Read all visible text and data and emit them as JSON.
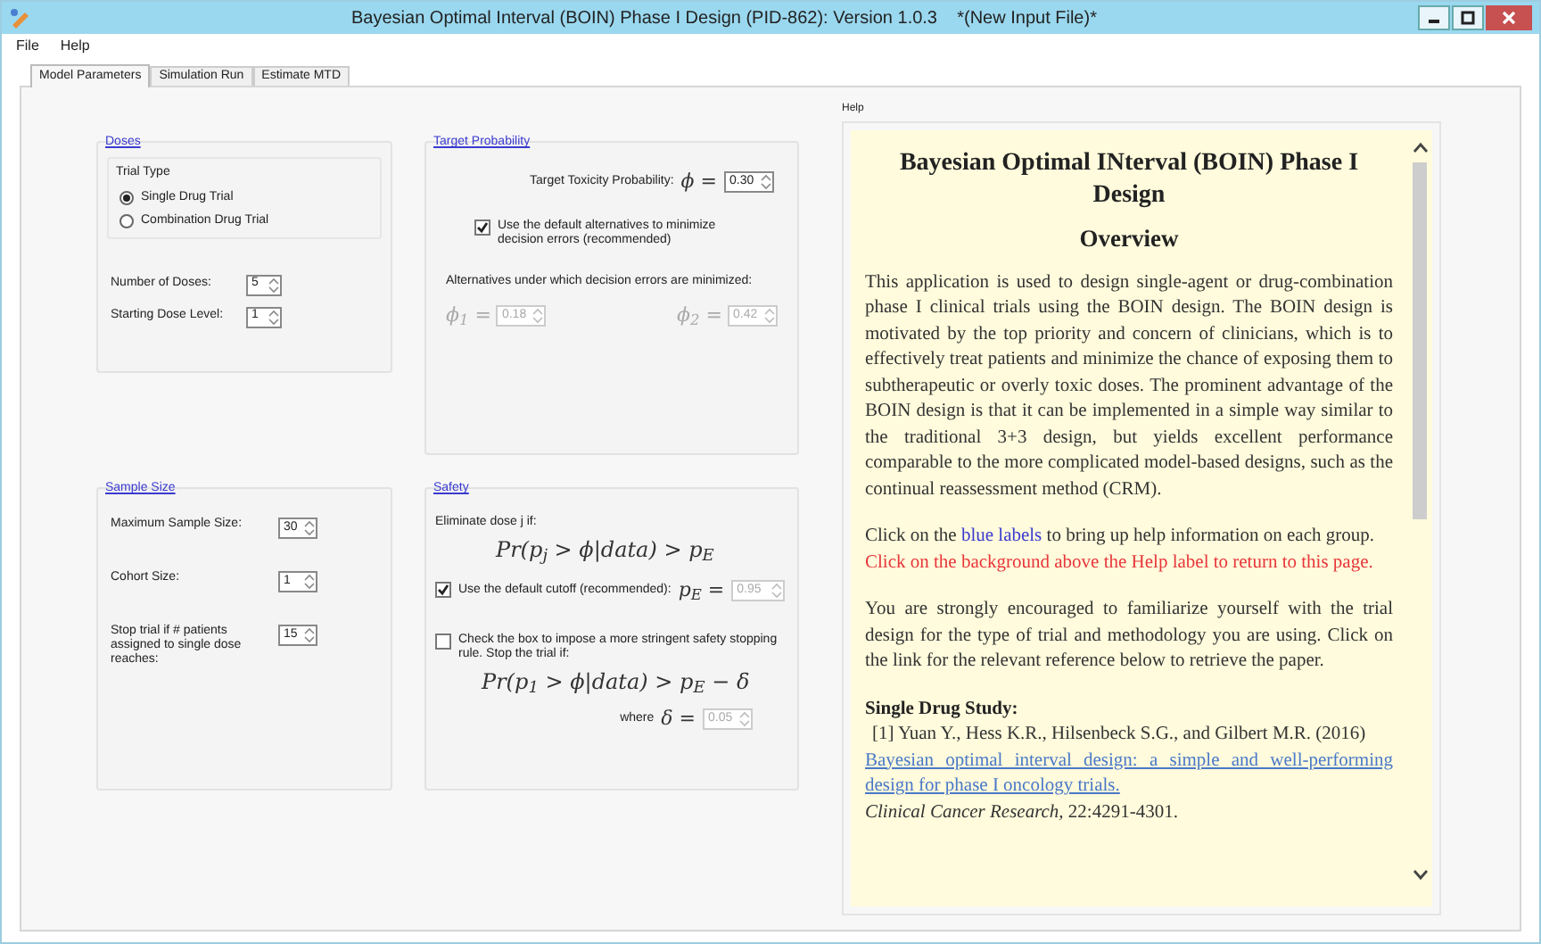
{
  "window": {
    "title": "Bayesian Optimal Interval (BOIN) Phase I Design (PID-862): Version 1.0.3    *(New Input File)*"
  },
  "window_controls": [
    {
      "kind": "minimize"
    },
    {
      "kind": "maximize"
    },
    {
      "kind": "close"
    }
  ],
  "menu": [
    "File",
    "Help"
  ],
  "tabs": [
    {
      "label": "Model Parameters",
      "selected": true
    },
    {
      "label": "Simulation Run",
      "selected": false
    },
    {
      "label": "Estimate MTD",
      "selected": false
    }
  ],
  "doses": {
    "title": "Doses",
    "trial_type": {
      "label": "Trial Type",
      "options": [
        {
          "label": "Single Drug Trial",
          "selected": true
        },
        {
          "label": "Combination Drug Trial",
          "selected": false
        }
      ]
    },
    "fields": [
      {
        "label": "Number of Doses:",
        "value": "5",
        "disabled": false
      },
      {
        "label": "Starting Dose Level:",
        "value": "1",
        "disabled": false
      }
    ]
  },
  "target_probability": {
    "title": "Target Probability",
    "target": {
      "label": "Target Toxicity Probability:",
      "symbol": "ϕ =",
      "value": "0.30",
      "disabled": false
    },
    "default_alternatives": {
      "label": "Use the default alternatives to minimize decision errors (recommended)",
      "checked": true
    },
    "alternatives_label": "Alternatives under which decision errors are minimized:",
    "alternatives": [
      {
        "symbol": "ϕ$_{1}$ =",
        "value": "0.18",
        "disabled": true
      },
      {
        "symbol": "ϕ$_{2}$ =",
        "value": "0.42",
        "disabled": true
      }
    ]
  },
  "sample_size": {
    "title": "Sample Size",
    "fields": [
      {
        "label": "Maximum Sample Size:",
        "value": "30",
        "disabled": false
      },
      {
        "label": "Cohort Size:",
        "value": "1",
        "disabled": false
      },
      {
        "label": "Stop trial if # patients assigned to single dose reaches:",
        "value": "15",
        "disabled": false
      }
    ]
  },
  "safety": {
    "title": "Safety",
    "eliminate_label": "Eliminate dose j if:",
    "formula": "Pr(p$_{j}$ > ϕ|data) > p$_{E}$",
    "default_cutoff": {
      "label": "Use the default cutoff (recommended):",
      "checked": true,
      "symbol": "p$_{E}$ =",
      "value": "0.95",
      "disabled": true
    },
    "stringent": {
      "label": "Check the box to impose a more stringent safety stopping rule. Stop the trial if:",
      "checked": false
    },
    "stringent_formula": "Pr(p$_{1}$ > ϕ|data) > p$_{E}$ − δ",
    "delta": {
      "label": "where",
      "symbol": "δ =",
      "value": "0.05",
      "disabled": true
    }
  },
  "help": {
    "title": "Help",
    "heading": "Bayesian Optimal INterval (BOIN) Phase I Design",
    "subheading": "Overview",
    "intro": "This application is used to design single-agent or drug-combination phase I clinical trials using the BOIN design. The BOIN design is motivated by the top priority and concern of clinicians, which is to effectively treat patients and minimize the chance of exposing them to subtherapeutic or overly toxic doses. The prominent advantage of the BOIN design is that it can be implemented in a simple way similar to the traditional 3+3 design, but yields excellent performance comparable to the more complicated model-based designs, such as the continual reassessment method (CRM).",
    "instructions": [
      {
        "kind": "text",
        "text": "Click on the "
      },
      {
        "kind": "link",
        "text": "blue labels"
      },
      {
        "kind": "text",
        "text": " to bring up help information on each group."
      }
    ],
    "warning": "Click on the background above the Help label to return to this page.",
    "encouragement": "You are strongly encouraged to familiarize yourself with the trial design for the type of trial and methodology you are using. Click on the link for the relevant reference below to retrieve the paper.",
    "section": "Single Drug Study:",
    "reference": {
      "citation": "[1] Yuan Y., Hess K.R., Hilsenbeck S.G., and Gilbert M.R. (2016)",
      "link": "Bayesian optimal interval design: a simple and well-performing design for phase I oncology trials.",
      "journal": "*Clinical Cancer Research,* 22:4291-4301."
    }
  }
}
